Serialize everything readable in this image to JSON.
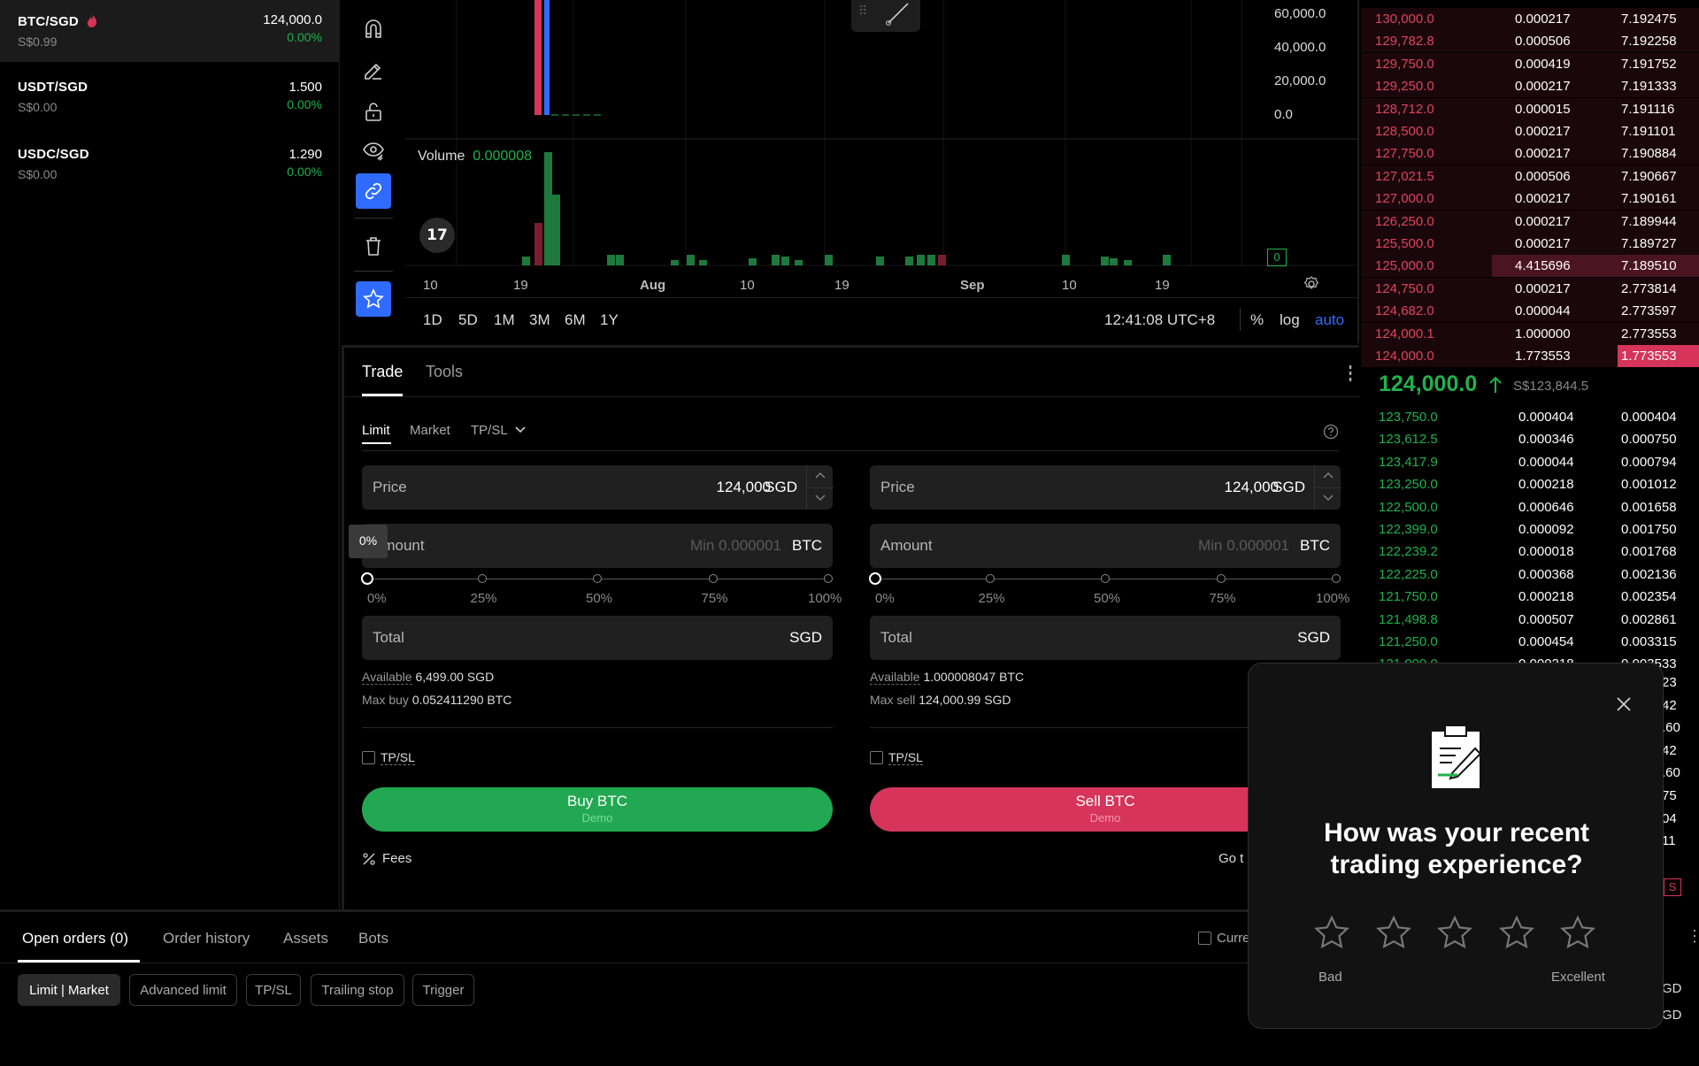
{
  "markets": [
    {
      "pair": "BTC/SGD",
      "sub": "S$0.99",
      "price": "124,000.0",
      "change": "0.00%",
      "hot": true
    },
    {
      "pair": "USDT/SGD",
      "sub": "S$0.00",
      "price": "1.500",
      "change": "0.00%"
    },
    {
      "pair": "USDC/SGD",
      "sub": "S$0.00",
      "price": "1.290",
      "change": "0.00%"
    }
  ],
  "toolbar": {
    "icons": [
      "magnet-icon",
      "pencil-ruler-icon",
      "lock-open-icon",
      "eye-icon",
      "link-icon",
      "trash-icon",
      "star-icon"
    ]
  },
  "chart": {
    "yaxis": [
      "60,000.0",
      "40,000.0",
      "20,000.0",
      "0.0"
    ],
    "volume_label": "Volume",
    "volume_value": "0.000008",
    "xaxis": [
      "10",
      "19",
      "Aug",
      "10",
      "19",
      "Sep",
      "10",
      "19"
    ],
    "volume_badge": "0",
    "ranges": [
      "1D",
      "5D",
      "1M",
      "3M",
      "6M",
      "1Y"
    ],
    "time": "12:41:08 UTC+8",
    "opt_pct": "%",
    "opt_log": "log",
    "opt_auto": "auto"
  },
  "book": {
    "asks": [
      [
        "130,000.0",
        "0.000217",
        "7.192475"
      ],
      [
        "129,782.8",
        "0.000506",
        "7.192258"
      ],
      [
        "129,750.0",
        "0.000419",
        "7.191752"
      ],
      [
        "129,250.0",
        "0.000217",
        "7.191333"
      ],
      [
        "128,712.0",
        "0.000015",
        "7.191116"
      ],
      [
        "128,500.0",
        "0.000217",
        "7.191101"
      ],
      [
        "127,750.0",
        "0.000217",
        "7.190884"
      ],
      [
        "127,021.5",
        "0.000506",
        "7.190667"
      ],
      [
        "127,000.0",
        "0.000217",
        "7.190161"
      ],
      [
        "126,250.0",
        "0.000217",
        "7.189944"
      ],
      [
        "125,500.0",
        "0.000217",
        "7.189727"
      ],
      [
        "125,000.0",
        "4.415696",
        "7.189510"
      ],
      [
        "124,750.0",
        "0.000217",
        "2.773814"
      ],
      [
        "124,682.0",
        "0.000044",
        "2.773597"
      ],
      [
        "124,000.1",
        "1.000000",
        "2.773553"
      ],
      [
        "124,000.0",
        "1.773553",
        "1.773553"
      ]
    ],
    "last_price": "124,000.0",
    "last_sgd": "S$123,844.5",
    "bids": [
      [
        "123,750.0",
        "0.000404",
        "0.000404"
      ],
      [
        "123,612.5",
        "0.000346",
        "0.000750"
      ],
      [
        "123,417.9",
        "0.000044",
        "0.000794"
      ],
      [
        "123,250.0",
        "0.000218",
        "0.001012"
      ],
      [
        "122,500.0",
        "0.000646",
        "0.001658"
      ],
      [
        "122,399.0",
        "0.000092",
        "0.001750"
      ],
      [
        "122,239.2",
        "0.000018",
        "0.001768"
      ],
      [
        "122,225.0",
        "0.000368",
        "0.002136"
      ],
      [
        "121,750.0",
        "0.000218",
        "0.002354"
      ],
      [
        "121,498.8",
        "0.000507",
        "0.002861"
      ],
      [
        "121,250.0",
        "0.000454",
        "0.003315"
      ],
      [
        "121,000.0",
        "0.000218",
        "0.003533"
      ]
    ],
    "hidden_tail": [
      "23",
      "42",
      ".60",
      "42",
      ".60",
      "75",
      "04",
      "11"
    ],
    "tail_badge": "S",
    "tail_gd": [
      "GD",
      "GD"
    ]
  },
  "trade": {
    "tabs": [
      "Trade",
      "Tools"
    ],
    "order_types": [
      "Limit",
      "Market",
      "TP/SL"
    ],
    "buy": {
      "price_label": "Price",
      "price_value": "124,000",
      "price_unit": "SGD",
      "amount_label": "Amount",
      "amount_placeholder": "Min 0.000001",
      "amount_unit": "BTC",
      "tooltip": "0%",
      "total_label": "Total",
      "total_unit": "SGD",
      "available_label": "Available",
      "available_value": "6,499.00 SGD",
      "max_label": "Max buy",
      "max_value": "0.052411290 BTC",
      "tpsl": "TP/SL",
      "button": "Buy BTC",
      "button_sub": "Demo"
    },
    "sell": {
      "price_label": "Price",
      "price_value": "124,000",
      "price_unit": "SGD",
      "amount_label": "Amount",
      "amount_placeholder": "Min 0.000001",
      "amount_unit": "BTC",
      "total_label": "Total",
      "total_unit": "SGD",
      "available_label": "Available",
      "available_value": "1.000008047 BTC",
      "max_label": "Max sell",
      "max_value": "124,000.99 SGD",
      "tpsl": "TP/SL",
      "button": "Sell BTC",
      "button_sub": "Demo"
    },
    "slider_marks": [
      "0%",
      "25%",
      "50%",
      "75%",
      "100%"
    ],
    "fees": "Fees",
    "goto": "Go t"
  },
  "bottom": {
    "tabs": [
      "Open orders (0)",
      "Order history",
      "Assets",
      "Bots"
    ],
    "filters": [
      "Limit | Market",
      "Advanced limit",
      "TP/SL",
      "Trailing stop",
      "Trigger"
    ],
    "current_label": "Curre"
  },
  "popup": {
    "title_line1": "How was your recent",
    "title_line2": "trading experience?",
    "low": "Bad",
    "high": "Excellent"
  },
  "colors": {
    "green": "#22b14c",
    "red": "#d6345a",
    "blue": "#2f6bff",
    "askbg": "#3a1118",
    "bidtext": "#22b14c"
  }
}
